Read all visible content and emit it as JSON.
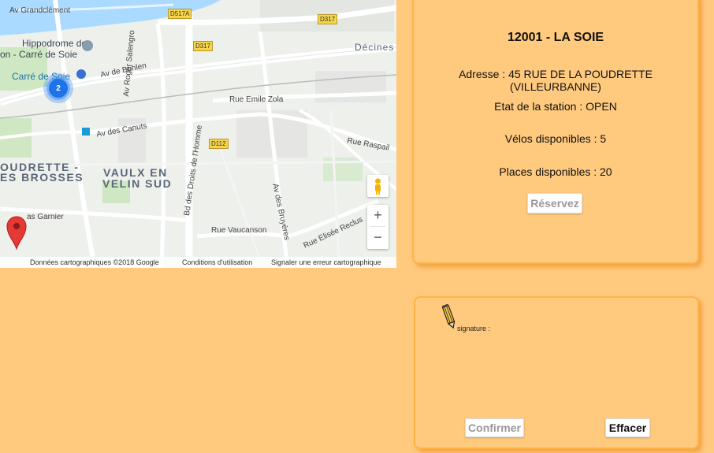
{
  "map": {
    "roads": {
      "av_grandclement": "Av Grandclément",
      "av_de_bohlen": "Av de Bohlen",
      "av_roger_salengro": "Av Roger Salengro",
      "rue_emile_zola": "Rue Emile Zola",
      "av_des_canuts": "Av des Canuts",
      "bd_droits_homme": "Bd des Droits de l'Homme",
      "rue_raspail": "Rue Raspail",
      "av_des_bruyeres": "Av des Bruyères",
      "rue_vaucanson": "Rue Vaucanson",
      "rue_elisee_reclus": "Rue Elisée Reclus",
      "as_garnier": "as Garnier"
    },
    "shields": {
      "d517a": "D517A",
      "d317_top": "D317",
      "d317_mid": "D317",
      "d112": "D112"
    },
    "pois": {
      "hippodrome_line1": "Hippodrome de",
      "hippodrome_line2": "on - Carré de Soie",
      "carre_de_soie": "Carré de Soie",
      "decines": "Décines"
    },
    "areas": {
      "poudrette_line1": "OUDRETTE -",
      "poudrette_line2": "ES BROSSES",
      "vaulx_line1": "VAULX EN",
      "vaulx_line2": "VELIN SUD"
    },
    "cluster_count": "2",
    "zoom_in": "+",
    "zoom_out": "−",
    "footer": {
      "copyright": "Données cartographiques ©2018 Google",
      "terms": "Conditions d'utilisation",
      "report": "Signaler une erreur cartographique"
    }
  },
  "station": {
    "title": "12001 - LA SOIE",
    "address": "Adresse : 45 RUE DE LA POUDRETTE (VILLEURBANNE)",
    "status": "Etat de la station : OPEN",
    "bikes": "Vélos disponibles : 5",
    "places": "Places disponibles : 20",
    "reserve_button": "Réservez"
  },
  "signature": {
    "label": "signature :",
    "confirm_button": "Confirmer",
    "clear_button": "Effacer"
  },
  "colors": {
    "background": "#ffc97e",
    "panel_border": "#ffb347",
    "marker": "#e53935",
    "cluster": "#1e73e8"
  }
}
